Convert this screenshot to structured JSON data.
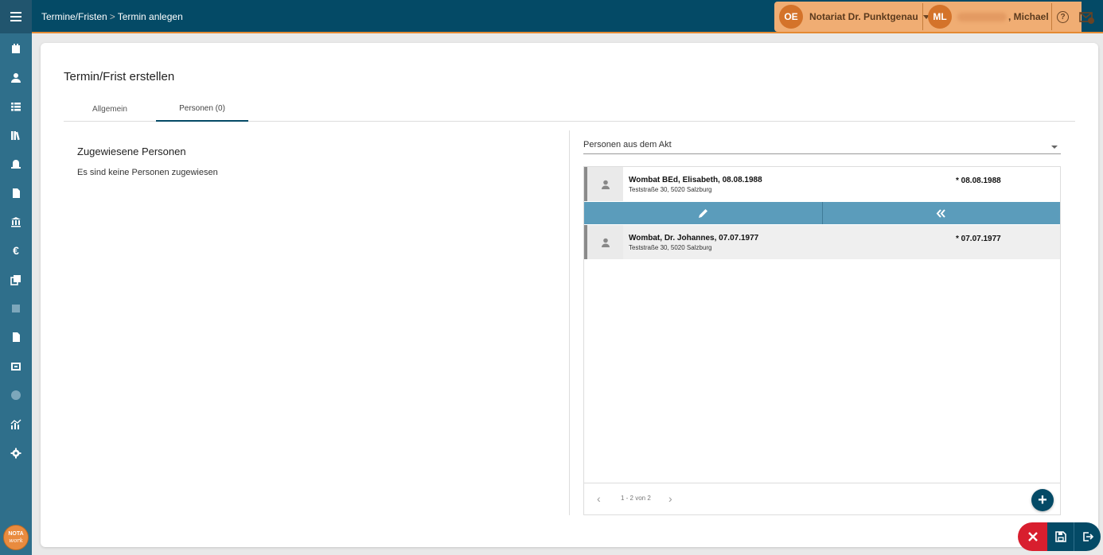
{
  "breadcrumb": {
    "parent": "Termine/Fristen",
    "separator": ">",
    "current": "Termin anlegen"
  },
  "org": {
    "initials": "OE",
    "name": "Notariat Dr. Punktgenau"
  },
  "user": {
    "initials": "ML",
    "name_visible": ", Michael"
  },
  "help": {
    "glyph": "?"
  },
  "sidebar": {
    "icons": [
      "menu-icon",
      "calendar-check-icon",
      "person-icon",
      "table-icon",
      "books-icon",
      "safe-icon",
      "document-icon",
      "bank-icon",
      "euro-icon",
      "copy-icon",
      "square-icon",
      "file-icon",
      "ruler-icon",
      "info-icon",
      "analytics-icon",
      "gear-icon"
    ]
  },
  "logo": {
    "line1": "NOTA",
    "line2": "work"
  },
  "page": {
    "title": "Termin/Frist erstellen"
  },
  "tabs": [
    {
      "label": "Allgemein"
    },
    {
      "label": "Personen (0)"
    }
  ],
  "left": {
    "heading": "Zugewiesene Personen",
    "empty": "Es sind keine Personen zugewiesen"
  },
  "right": {
    "select_value": "Personen aus dem Akt",
    "persons": [
      {
        "name": "Wombat BEd, Elisabeth, 08.08.1988",
        "address": "Teststraße 30, 5020 Salzburg",
        "dob": "* 08.08.1988"
      },
      {
        "name": "Wombat, Dr. Johannes, 07.07.1977",
        "address": "Teststraße 30, 5020 Salzburg",
        "dob": "* 07.07.1977"
      }
    ],
    "pager": {
      "text": "1 - 2 von 2",
      "prev": "‹",
      "next": "›"
    },
    "add_label": "+"
  },
  "colors": {
    "topbar": "#044a66",
    "sidebar": "#2f6f8b",
    "accent": "#e48a33",
    "action_bar": "#5b9cbb",
    "cancel": "#d81e2e"
  }
}
